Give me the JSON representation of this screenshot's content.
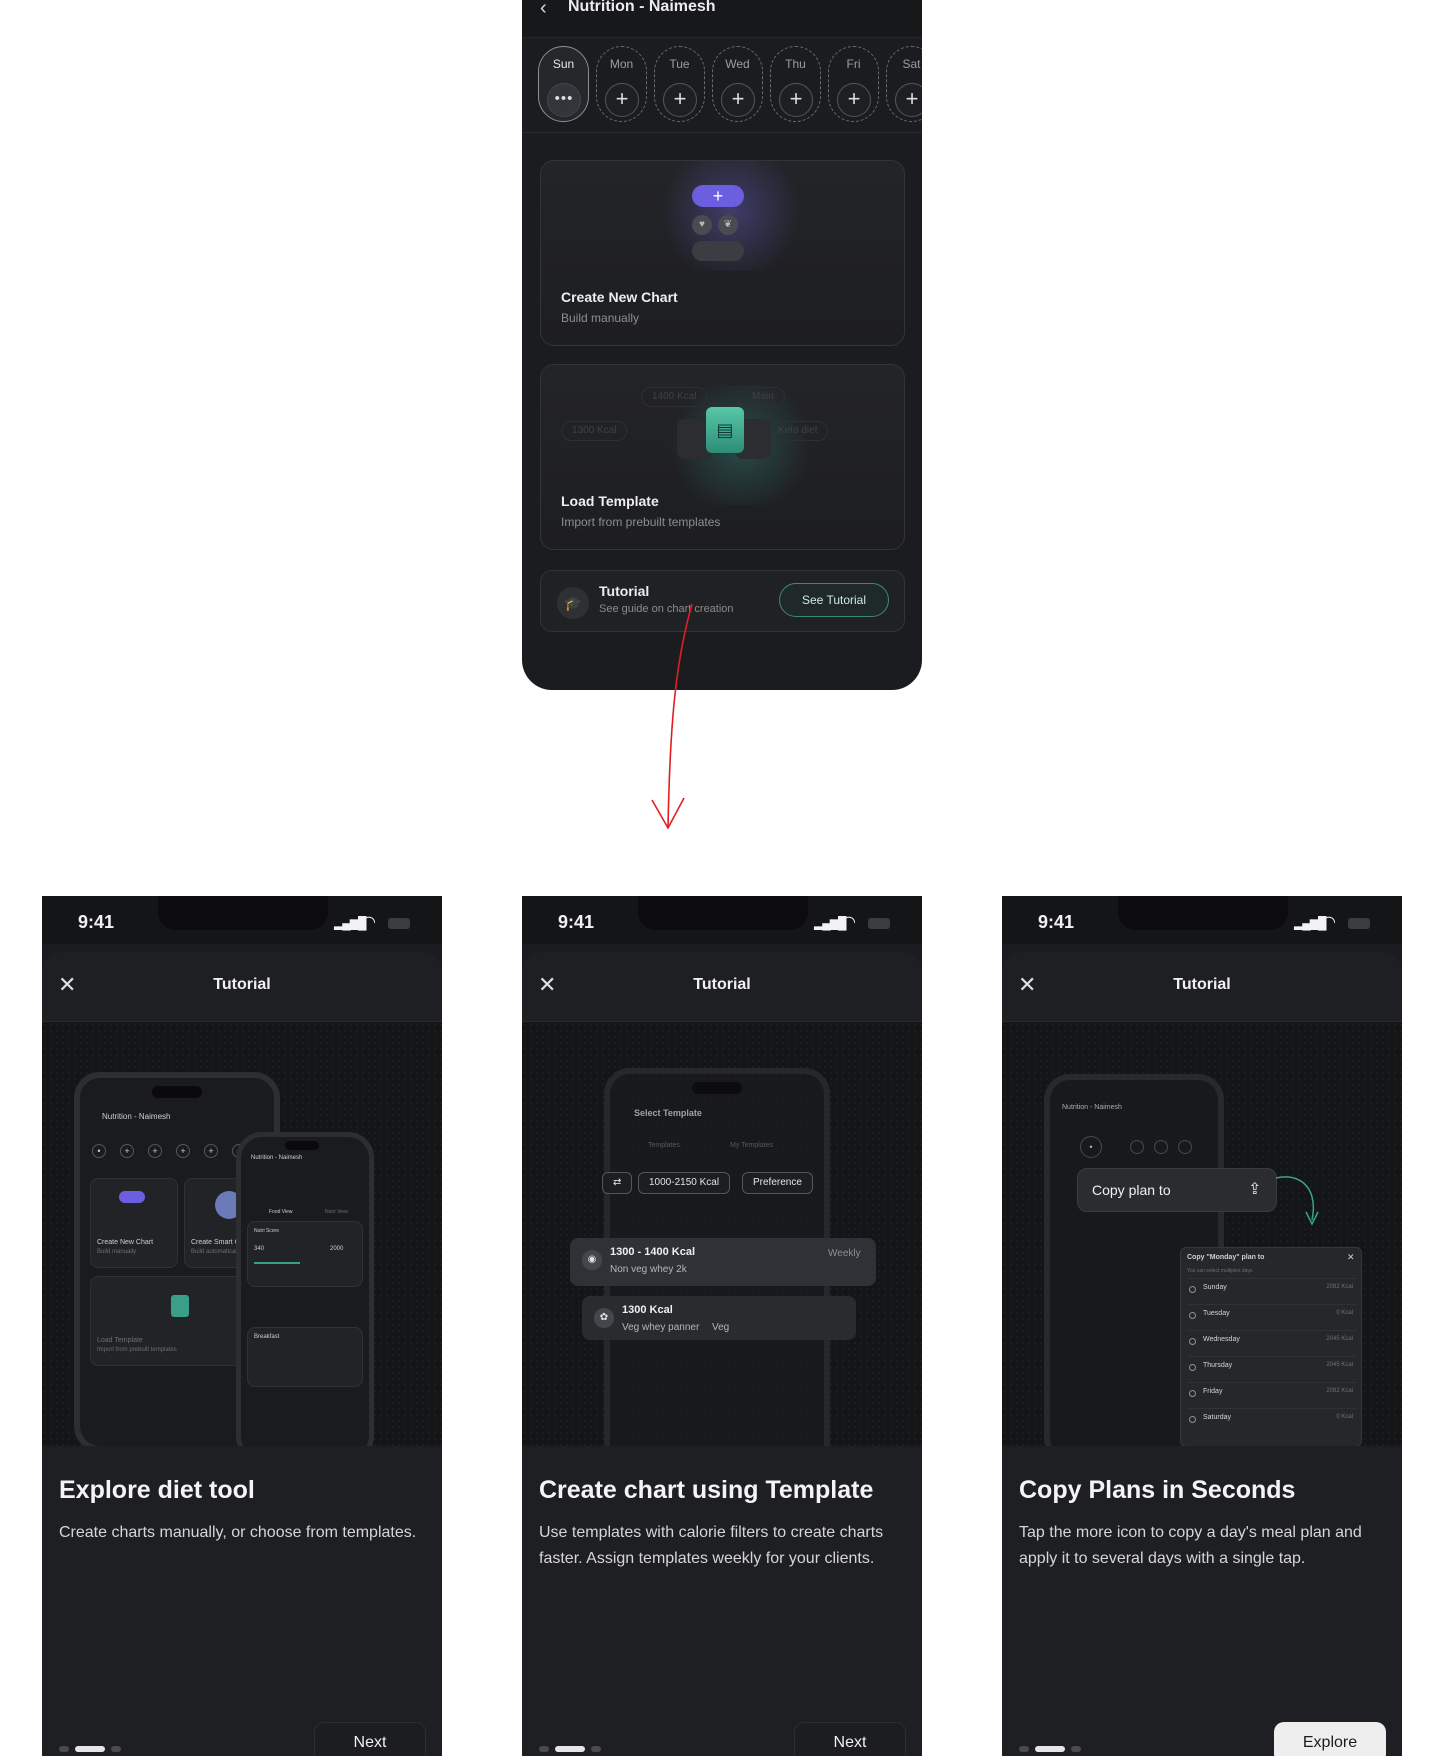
{
  "top_screen": {
    "header_title": "Nutrition - Naimesh",
    "days": [
      {
        "label": "Sun",
        "btn": "•••",
        "active": true
      },
      {
        "label": "Mon",
        "btn": "+"
      },
      {
        "label": "Tue",
        "btn": "+"
      },
      {
        "label": "Wed",
        "btn": "+"
      },
      {
        "label": "Thu",
        "btn": "+"
      },
      {
        "label": "Fri",
        "btn": "+"
      },
      {
        "label": "Sat",
        "btn": "+"
      }
    ],
    "create_card": {
      "title": "Create New Chart",
      "subtitle": "Build manually",
      "plus": "+"
    },
    "load_card": {
      "title": "Load Template",
      "subtitle": "Import from prebuilt templates",
      "ghost_pills": [
        "1400 Kcal",
        "Main",
        "1300 Kcal",
        "Keto diet"
      ]
    },
    "tutorial": {
      "title": "Tutorial",
      "subtitle": "See guide on chart creation",
      "button": "See Tutorial"
    }
  },
  "screens": [
    {
      "time": "9:41",
      "title": "Tutorial",
      "headline": "Explore diet tool",
      "description": "Create charts manually, or choose from templates.",
      "button": "Next",
      "illus": {
        "header": "Nutrition - Naimesh",
        "card1": "Create New Chart",
        "card1_sub": "Build manually",
        "card2": "Create Smart Chart",
        "card2_sub": "Build automatically",
        "load": "Load Template",
        "load_sub": "Import from prebuilt templates",
        "second_header": "Nutrition - Naimesh",
        "food_view": "Food View",
        "nutri_view": "Nutri View",
        "nutri_score": "Nutri Score",
        "kcal_consumed": "340",
        "kcal_total": "2000",
        "breakfast": "Breakfast"
      }
    },
    {
      "time": "9:41",
      "title": "Tutorial",
      "headline": "Create chart using Template",
      "description": "Use templates with calorie filters to create charts faster. Assign templates weekly for your clients.",
      "button": "Next",
      "illus": {
        "header": "Select Template",
        "tab1": "Templates",
        "tab2": "My Templates",
        "chip_filter": "1000-2150 Kcal",
        "chip_pref": "Preference",
        "tpl1_title": "1300 - 1400 Kcal",
        "tpl1_sub": "Non veg whey 2k",
        "tpl1_tag": "Weekly",
        "tpl2_title": "1300 Kcal",
        "tpl2_sub": "Veg whey panner",
        "tpl2_tag": "Veg"
      }
    },
    {
      "time": "9:41",
      "title": "Tutorial",
      "headline": "Copy Plans in Seconds",
      "description": "Tap the more icon to copy a day's meal plan and apply it to several days with a single tap.",
      "button": "Explore",
      "illus": {
        "header": "Nutrition - Naimesh",
        "copy_label": "Copy plan to",
        "panel_title": "Copy \"Monday\" plan to",
        "panel_hint": "You can select multiples days",
        "days": [
          {
            "name": "Sunday",
            "kcal": "2082 Kcal"
          },
          {
            "name": "Tuesday",
            "kcal": "0 Kcal"
          },
          {
            "name": "Wednesday",
            "kcal": "2045 Kcal"
          },
          {
            "name": "Thursday",
            "kcal": "2045 Kcal"
          },
          {
            "name": "Friday",
            "kcal": "2082 Kcal"
          },
          {
            "name": "Saturday",
            "kcal": "0 Kcal"
          }
        ]
      }
    }
  ],
  "colors": {
    "accent_purple": "#6b5fe0",
    "accent_teal": "#3e8a79",
    "arrow_red": "#e02020"
  },
  "icons": [
    "back-arrow-icon",
    "plus-icon",
    "more-icon",
    "graduation-cap-icon",
    "close-icon",
    "signal-icon",
    "wifi-icon",
    "battery-icon",
    "share-icon",
    "document-icon"
  ]
}
